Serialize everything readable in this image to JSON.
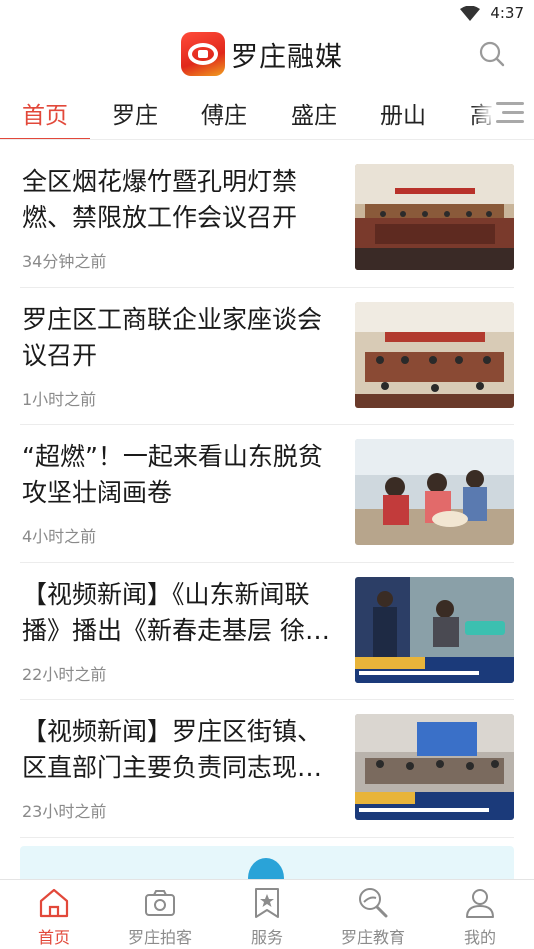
{
  "status_bar": {
    "time": "4:37"
  },
  "header": {
    "app_name": "罗庄融媒"
  },
  "tabs": [
    {
      "label": "首页",
      "active": true
    },
    {
      "label": "罗庄"
    },
    {
      "label": "傅庄"
    },
    {
      "label": "盛庄"
    },
    {
      "label": "册山"
    },
    {
      "label": "高"
    }
  ],
  "news": [
    {
      "title": "全区烟花爆竹暨孔明灯禁燃、禁限放工作会议召开",
      "time": "34分钟之前"
    },
    {
      "title": "罗庄区工商联企业家座谈会议召开",
      "time": "1小时之前"
    },
    {
      "title": "“超燃”！一起来看山东脱贫攻坚壮阔画卷",
      "time": "4小时之前"
    },
    {
      "title": "【视频新闻】《山东新闻联播》播出《新春走基层 徐…",
      "time": "22小时之前"
    },
    {
      "title": "【视频新闻】罗庄区街镇、区直部门主要负责同志现场…",
      "time": "23小时之前"
    }
  ],
  "bottom_nav": [
    {
      "label": "首页",
      "icon": "home-icon",
      "active": true
    },
    {
      "label": "罗庄拍客",
      "icon": "camera-icon"
    },
    {
      "label": "服务",
      "icon": "bookmark-star-icon"
    },
    {
      "label": "罗庄教育",
      "icon": "education-icon"
    },
    {
      "label": "我的",
      "icon": "profile-icon"
    }
  ],
  "colors": {
    "accent": "#e2483a",
    "inactive": "#8c8c8c",
    "text": "#1a1a1a"
  }
}
